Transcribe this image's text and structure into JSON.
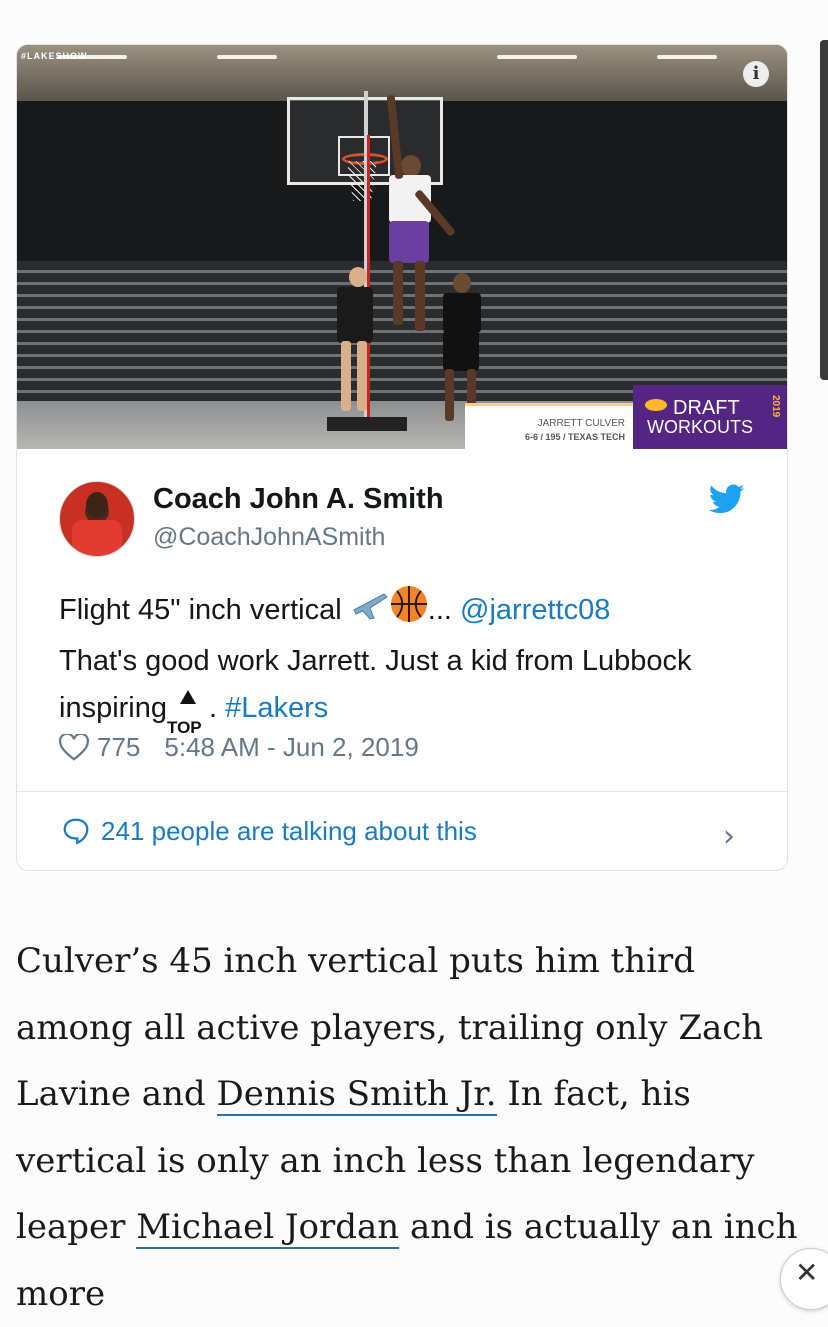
{
  "media": {
    "watermark": "#LAKESHOW",
    "info_icon": "info-icon",
    "caption_name": "JARRETT CULVER",
    "caption_stats": "6-6 / 195 / TEXAS TECH",
    "badge_line1": "DRAFT",
    "badge_line2": "WORKOUTS",
    "badge_year": "2019"
  },
  "tweet": {
    "author_name": "Coach John A. Smith",
    "screen_name": "@CoachJohnASmith",
    "text_part1": "Flight 45\" inch vertical ",
    "emoji_plane": "✈",
    "emoji_ball": "🏀",
    "ellipsis": "... ",
    "mention": "@jarrettc08",
    "text_part2": "That's good work Jarrett. Just a kid from Lubbock inspiring",
    "emoji_top": "TOP",
    "text_part3": ". ",
    "hashtag": "#Lakers",
    "likes": "775",
    "timestamp": "5:48 AM - Jun 2, 2019",
    "talking": "241 people are talking about this",
    "brand_color": "#1DA1F2"
  },
  "article": {
    "p1": "Culver’s 45 inch vertical puts him third among all active players, trailing only Zach Lavine and ",
    "link1": "Dennis Smith Jr.",
    "p2": " In fact, his vertical is only an inch less than legendary leaper ",
    "link2": "Michael Jordan",
    "p3": " and is actually an inch more"
  },
  "close_label": "✕"
}
